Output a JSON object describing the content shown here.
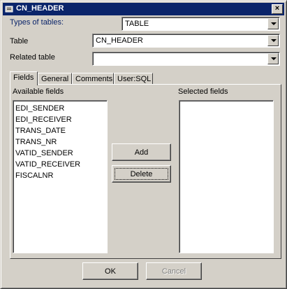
{
  "window": {
    "title": "CN_HEADER"
  },
  "form": {
    "types_label": "Types of tables:",
    "types_value": "TABLE",
    "table_label": "Table",
    "table_value": "CN_HEADER",
    "related_label": "Related table",
    "related_value": ""
  },
  "tabs": [
    {
      "label": "Fields"
    },
    {
      "label": "General"
    },
    {
      "label": "Comments"
    },
    {
      "label": "User:SQL"
    }
  ],
  "fields_tab": {
    "available_label": "Available fields",
    "selected_label": "Selected fields",
    "available_items": [
      "EDI_SENDER",
      "EDI_RECEIVER",
      "TRANS_DATE",
      "TRANS_NR",
      "VATID_SENDER",
      "VATID_RECEIVER",
      "FISCALNR"
    ],
    "add_label": "Add",
    "delete_label": "Delete"
  },
  "footer": {
    "ok_label": "OK",
    "cancel_label": "Cancel"
  },
  "colors": {
    "titlebar": "#0a246a",
    "face": "#d4d0c8"
  }
}
